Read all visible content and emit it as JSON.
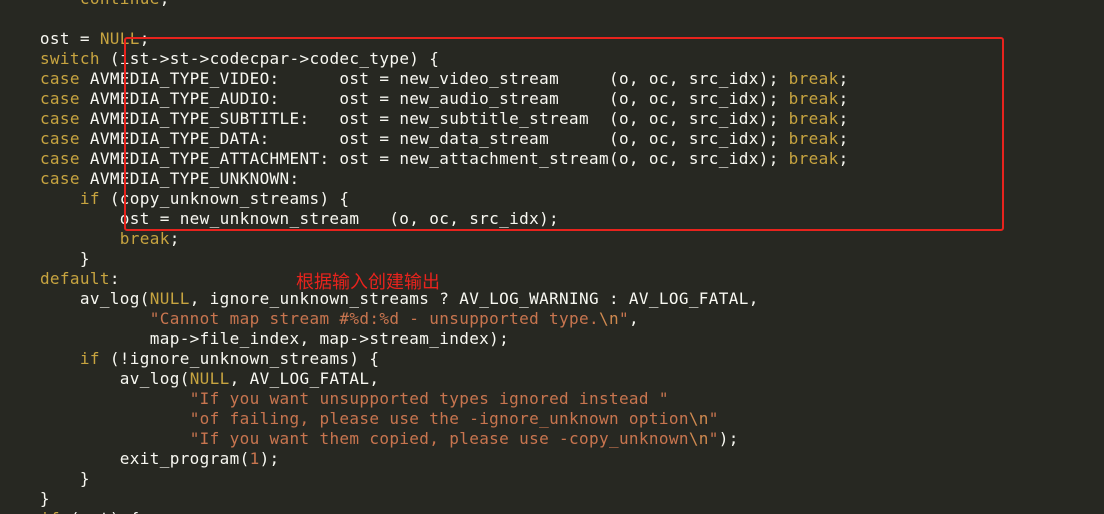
{
  "annotation": "根据输入创建输出",
  "lines": [
    [
      {
        "t": "        "
      },
      {
        "t": "continue",
        "c": "kw"
      },
      {
        "t": ";"
      }
    ],
    [
      {
        "t": ""
      }
    ],
    [
      {
        "t": "    ost = "
      },
      {
        "t": "NULL",
        "c": "kw"
      },
      {
        "t": ";"
      }
    ],
    [
      {
        "t": "    "
      },
      {
        "t": "switch",
        "c": "kw"
      },
      {
        "t": " (ist->st->codecpar->codec_type) {"
      }
    ],
    [
      {
        "t": "    "
      },
      {
        "t": "case",
        "c": "kw"
      },
      {
        "t": " AVMEDIA_TYPE_VIDEO:      ost = new_video_stream     (o, oc, src_idx); "
      },
      {
        "t": "break",
        "c": "kw"
      },
      {
        "t": ";"
      }
    ],
    [
      {
        "t": "    "
      },
      {
        "t": "case",
        "c": "kw"
      },
      {
        "t": " AVMEDIA_TYPE_AUDIO:      ost = new_audio_stream     (o, oc, src_idx); "
      },
      {
        "t": "break",
        "c": "kw"
      },
      {
        "t": ";"
      }
    ],
    [
      {
        "t": "    "
      },
      {
        "t": "case",
        "c": "kw"
      },
      {
        "t": " AVMEDIA_TYPE_SUBTITLE:   ost = new_subtitle_stream  (o, oc, src_idx); "
      },
      {
        "t": "break",
        "c": "kw"
      },
      {
        "t": ";"
      }
    ],
    [
      {
        "t": "    "
      },
      {
        "t": "case",
        "c": "kw"
      },
      {
        "t": " AVMEDIA_TYPE_DATA:       ost = new_data_stream      (o, oc, src_idx); "
      },
      {
        "t": "break",
        "c": "kw"
      },
      {
        "t": ";"
      }
    ],
    [
      {
        "t": "    "
      },
      {
        "t": "case",
        "c": "kw"
      },
      {
        "t": " AVMEDIA_TYPE_ATTACHMENT: ost = new_attachment_stream(o, oc, src_idx); "
      },
      {
        "t": "break",
        "c": "kw"
      },
      {
        "t": ";"
      }
    ],
    [
      {
        "t": "    "
      },
      {
        "t": "case",
        "c": "kw"
      },
      {
        "t": " AVMEDIA_TYPE_UNKNOWN:"
      }
    ],
    [
      {
        "t": "        "
      },
      {
        "t": "if",
        "c": "kw"
      },
      {
        "t": " (copy_unknown_streams) {"
      }
    ],
    [
      {
        "t": "            ost = new_unknown_stream   (o, oc, src_idx);"
      }
    ],
    [
      {
        "t": "            "
      },
      {
        "t": "break",
        "c": "kw"
      },
      {
        "t": ";"
      }
    ],
    [
      {
        "t": "        }"
      }
    ],
    [
      {
        "t": "    "
      },
      {
        "t": "default",
        "c": "kw"
      },
      {
        "t": ":"
      }
    ],
    [
      {
        "t": "        av_log("
      },
      {
        "t": "NULL",
        "c": "kw"
      },
      {
        "t": ", ignore_unknown_streams ? AV_LOG_WARNING : AV_LOG_FATAL,"
      }
    ],
    [
      {
        "t": "               "
      },
      {
        "t": "\"Cannot map stream #%d:%d - unsupported type.",
        "c": "str"
      },
      {
        "t": "\\n",
        "c": "esc"
      },
      {
        "t": "\"",
        "c": "str"
      },
      {
        "t": ","
      }
    ],
    [
      {
        "t": "               map->file_index, map->stream_index);"
      }
    ],
    [
      {
        "t": "        "
      },
      {
        "t": "if",
        "c": "kw"
      },
      {
        "t": " (!ignore_unknown_streams) {"
      }
    ],
    [
      {
        "t": "            av_log("
      },
      {
        "t": "NULL",
        "c": "kw"
      },
      {
        "t": ", AV_LOG_FATAL,"
      }
    ],
    [
      {
        "t": "                   "
      },
      {
        "t": "\"If you want unsupported types ignored instead \"",
        "c": "str"
      }
    ],
    [
      {
        "t": "                   "
      },
      {
        "t": "\"of failing, please use the -ignore_unknown option",
        "c": "str"
      },
      {
        "t": "\\n",
        "c": "esc"
      },
      {
        "t": "\"",
        "c": "str"
      }
    ],
    [
      {
        "t": "                   "
      },
      {
        "t": "\"If you want them copied, please use -copy_unknown",
        "c": "str"
      },
      {
        "t": "\\n",
        "c": "esc"
      },
      {
        "t": "\"",
        "c": "str"
      },
      {
        "t": ");"
      }
    ],
    [
      {
        "t": "            exit_program("
      },
      {
        "t": "1",
        "c": "num"
      },
      {
        "t": ");"
      }
    ],
    [
      {
        "t": "        }"
      }
    ],
    [
      {
        "t": "    }"
      }
    ],
    [
      {
        "t": "    "
      },
      {
        "t": "if",
        "c": "kw"
      },
      {
        "t": " (ost) {"
      }
    ]
  ]
}
